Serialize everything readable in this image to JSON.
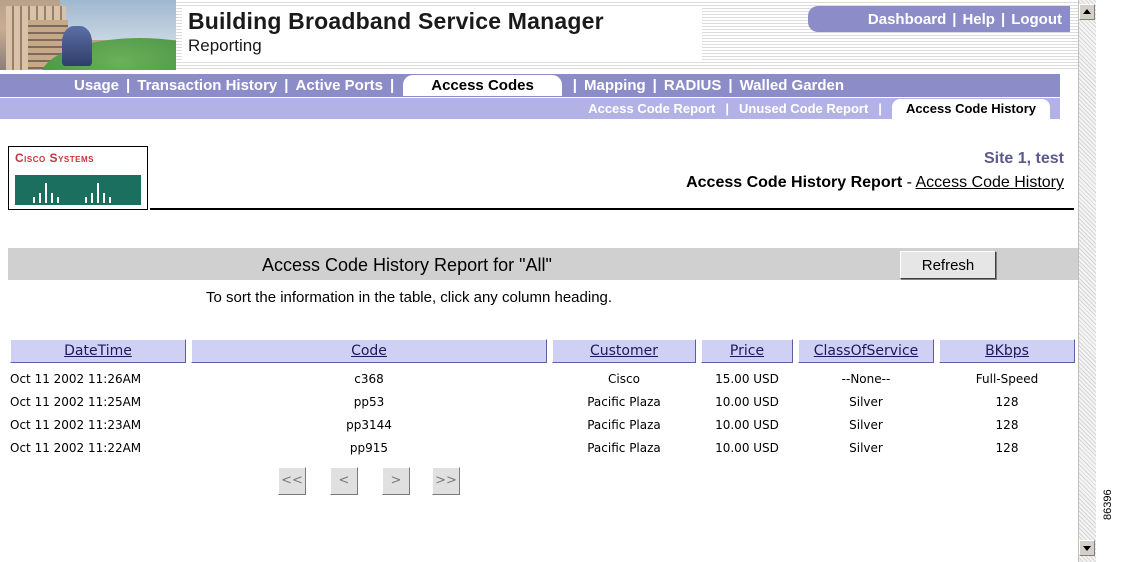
{
  "header": {
    "app_title": "Building Broadband Service Manager",
    "app_subtitle": "Reporting",
    "utility_links": [
      "Dashboard",
      "Help",
      "Logout"
    ]
  },
  "primary_nav": {
    "items": [
      "Usage",
      "Transaction History",
      "Active Ports",
      "Access Codes",
      "Mapping",
      "RADIUS",
      "Walled Garden"
    ],
    "active": "Access Codes"
  },
  "secondary_nav": {
    "items": [
      "Access Code Report",
      "Unused Code Report",
      "Access Code History"
    ],
    "active": "Access Code History"
  },
  "logo": {
    "text": "Cisco Systems"
  },
  "site": {
    "name": "Site 1, test",
    "report_name": "Access Code History Report",
    "separator": "-",
    "report_link": "Access Code History"
  },
  "report": {
    "title": "Access Code History Report for \"All\"",
    "refresh_label": "Refresh",
    "sort_hint": "To sort the information in the table, click any column heading."
  },
  "table": {
    "columns": [
      "DateTime",
      "Code",
      "Customer",
      "Price",
      "ClassOfService",
      "BKbps"
    ],
    "rows": [
      [
        "Oct 11 2002 11:26AM",
        "c368",
        "Cisco",
        "15.00 USD",
        "--None--",
        "Full-Speed"
      ],
      [
        "Oct 11 2002 11:25AM",
        "pp53",
        "Pacific Plaza",
        "10.00 USD",
        "Silver",
        "128"
      ],
      [
        "Oct 11 2002 11:23AM",
        "pp3144",
        "Pacific Plaza",
        "10.00 USD",
        "Silver",
        "128"
      ],
      [
        "Oct 11 2002 11:22AM",
        "pp915",
        "Pacific Plaza",
        "10.00 USD",
        "Silver",
        "128"
      ]
    ]
  },
  "pager": {
    "first": "<<",
    "prev": "<",
    "next": ">",
    "last": ">>"
  },
  "figure_id": "86396",
  "colors": {
    "nav_primary": "#8c8cc8",
    "nav_secondary": "#b2b2e6",
    "column_header": "#d0d0f5",
    "report_band": "#d0d0d0",
    "site_name": "#5a5a8e",
    "cisco_red": "#c5343c"
  }
}
